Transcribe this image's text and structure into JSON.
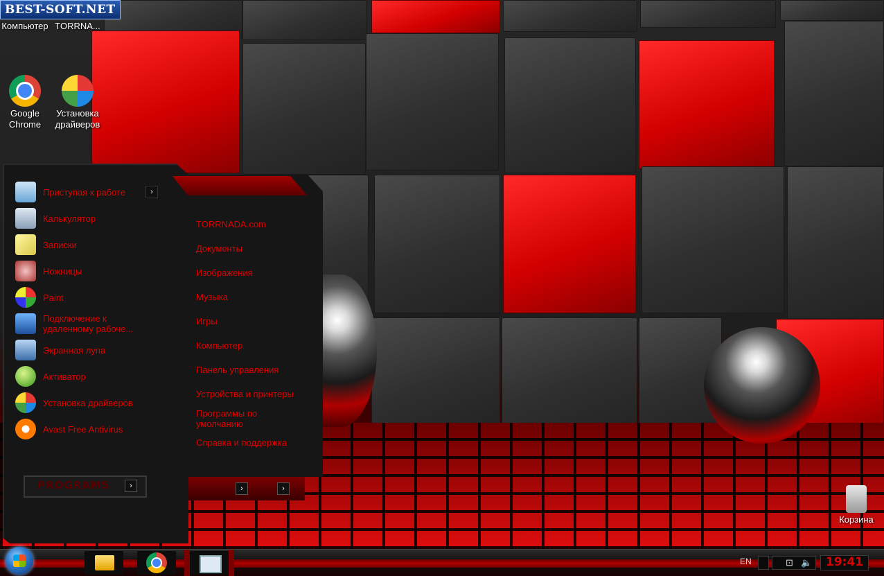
{
  "watermark": "BEST-SOFT.NET",
  "desktop_icons": [
    {
      "label": "Компьютер"
    },
    {
      "label": "TORRNA..."
    },
    {
      "label": "Google Chrome"
    },
    {
      "label": "Установка драйверов"
    },
    {
      "label": "Корзина"
    }
  ],
  "start_menu": {
    "left_items": [
      {
        "label": "Приступая к работе",
        "icon": "getting-started-icon",
        "has_arrow": true
      },
      {
        "label": "Калькулятор",
        "icon": "calculator-icon"
      },
      {
        "label": "Записки",
        "icon": "sticky-notes-icon"
      },
      {
        "label": "Ножницы",
        "icon": "snipping-tool-icon"
      },
      {
        "label": "Paint",
        "icon": "paint-icon"
      },
      {
        "label": "Подключение к удаленному рабоче...",
        "icon": "remote-desktop-icon"
      },
      {
        "label": "Экранная лупа",
        "icon": "magnifier-icon"
      },
      {
        "label": "Активатор",
        "icon": "activator-icon"
      },
      {
        "label": "Установка драйверов",
        "icon": "driver-install-icon"
      },
      {
        "label": "Avast Free Antivirus",
        "icon": "avast-icon"
      }
    ],
    "right_links": [
      "TORRNADA.com",
      "Документы",
      "Изображения",
      "Музыка",
      "Игры",
      "Компьютер",
      "Панель управления",
      "Устройства и принтеры",
      "Программы по умолчанию",
      "Справка и поддержка"
    ],
    "programs_label": "PROGRAMS",
    "arrow_glyph": "›"
  },
  "taskbar": {
    "lang": "EN",
    "clock": "19:41"
  },
  "colors": {
    "accent": "#e00000",
    "menu_bg": "#161616"
  }
}
